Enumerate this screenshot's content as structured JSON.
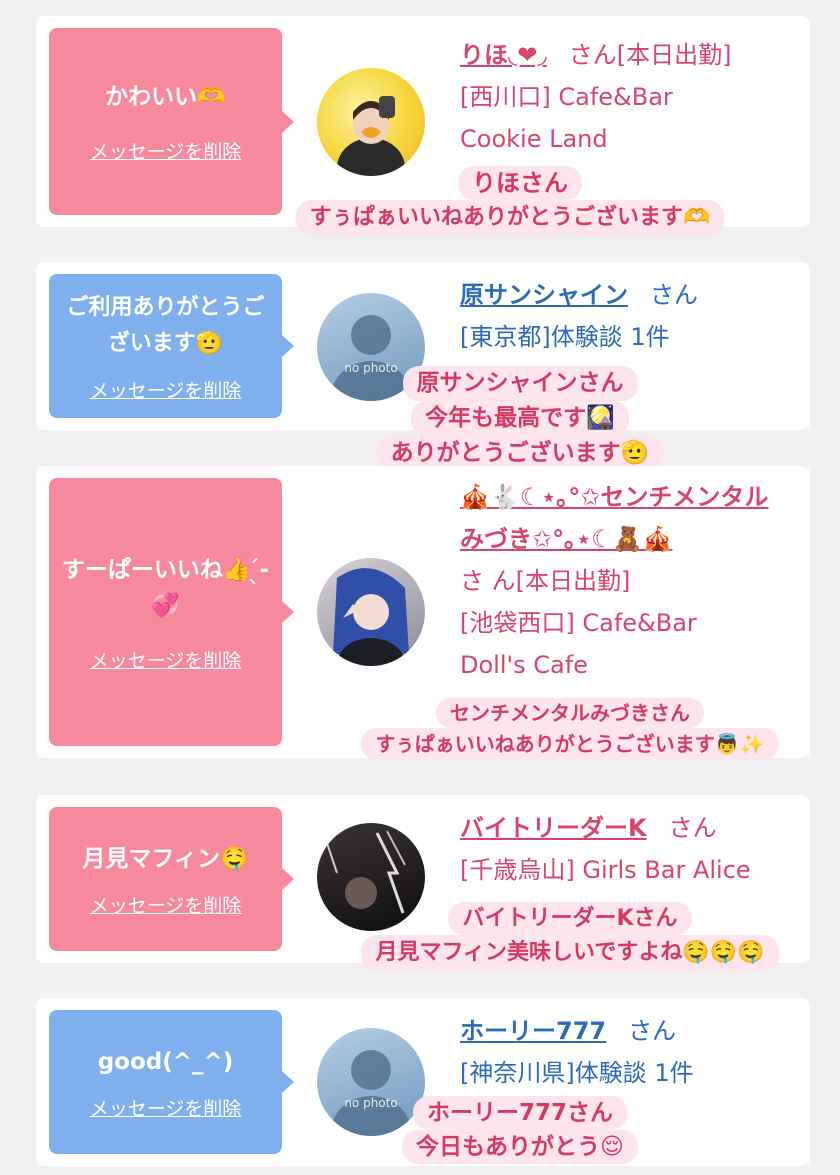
{
  "cards": [
    {
      "message": "かわいい🫶",
      "delete_label": "メッセージを削除",
      "name": "りほ◟❤︎◞",
      "san": "さん",
      "lines": [
        "[本日出勤]",
        "[西川口] Cafe&Bar",
        "Cookie Land"
      ],
      "caption": [
        "りほさん",
        "すぅぱぁいいねありがとうございます🫶"
      ]
    },
    {
      "message": "ご利用ありがとうございます🫡",
      "delete_label": "メッセージを削除",
      "name": "原サンシャイン",
      "san": "さん",
      "lines": [
        "[東京都]体験談 1件"
      ],
      "avatar_label": "no photo",
      "caption": [
        "原サンシャインさん",
        "今年も最高です🎑",
        "ありがとうございます🫡"
      ]
    },
    {
      "message": "すーぱーいいね👍 ̖́-💞",
      "delete_label": "メッセージを削除",
      "name": "🎪🐇☾⋆｡°✩センチメンタルみづき✩°｡⋆☾🧸🎪",
      "san": "さ ん",
      "lines": [
        "[本日出勤]",
        "[池袋西口] Cafe&Bar",
        "Doll's Cafe"
      ],
      "caption": [
        "センチメンタルみづきさん",
        "すぅぱぁいいねありがとうございます👼✨"
      ]
    },
    {
      "message": "月見マフィン🤤",
      "delete_label": "メッセージを削除",
      "name": "バイトリーダーK",
      "san": "さん",
      "lines": [
        "[千歳烏山] Girls Bar Alice"
      ],
      "caption": [
        "バイトリーダーKさん",
        "月見マフィン美味しいですよね🤤🤤🤤"
      ]
    },
    {
      "message": "good(^_^)",
      "delete_label": "メッセージを削除",
      "name": "ホーリー777",
      "san": "さん",
      "lines": [
        "[神奈川県]体験談 1件"
      ],
      "avatar_label": "no photo",
      "caption": [
        "ホーリー777さん",
        "今日もありがとう😌"
      ]
    }
  ],
  "colors": {
    "pink_bubble": "#f7899d",
    "blue_bubble": "#7fb0ee",
    "pink_text": "#d8456a",
    "blue_text": "#2f69b7",
    "caption_bg": "#fde4ec"
  }
}
